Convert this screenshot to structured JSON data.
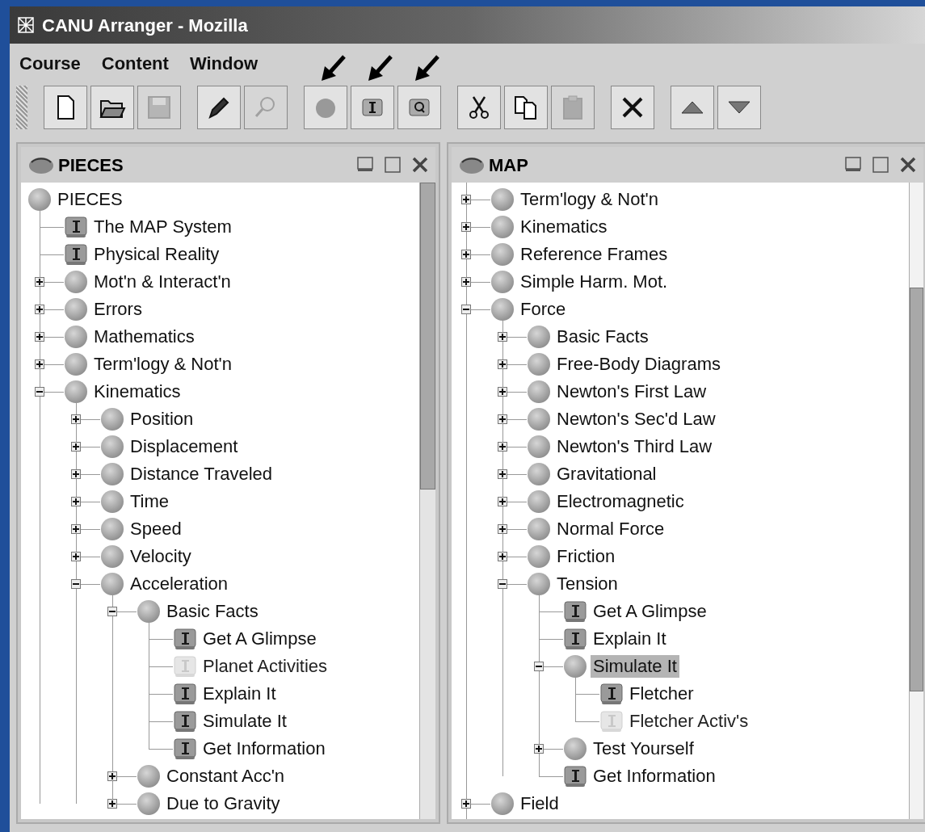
{
  "window": {
    "title": "CANU Arranger - Mozilla"
  },
  "menu": [
    "Course",
    "Content",
    "Window"
  ],
  "toolbar": [
    {
      "kind": "new",
      "disabled": false,
      "marked": false
    },
    {
      "kind": "open",
      "disabled": false,
      "marked": false
    },
    {
      "kind": "save",
      "disabled": true,
      "marked": false
    },
    {
      "kind": "sep"
    },
    {
      "kind": "pen",
      "disabled": false,
      "marked": false
    },
    {
      "kind": "find",
      "disabled": true,
      "marked": false
    },
    {
      "kind": "sep"
    },
    {
      "kind": "topic",
      "disabled": false,
      "marked": true
    },
    {
      "kind": "piece",
      "disabled": false,
      "marked": true
    },
    {
      "kind": "quiz",
      "disabled": false,
      "marked": true
    },
    {
      "kind": "sep"
    },
    {
      "kind": "cut",
      "disabled": false,
      "marked": false
    },
    {
      "kind": "copy",
      "disabled": false,
      "marked": false
    },
    {
      "kind": "paste",
      "disabled": true,
      "marked": false
    },
    {
      "kind": "sep"
    },
    {
      "kind": "delete",
      "disabled": false,
      "marked": false
    },
    {
      "kind": "sep"
    },
    {
      "kind": "up",
      "disabled": false,
      "marked": false
    },
    {
      "kind": "down",
      "disabled": false,
      "marked": false
    }
  ],
  "pieces": {
    "title": "PIECES",
    "root": {
      "kind": "topic",
      "label": "PIECES",
      "selected": false,
      "children": [
        {
          "kind": "piece",
          "label": "The MAP System",
          "dimmed": false,
          "selected": false
        },
        {
          "kind": "piece",
          "label": "Physical Reality",
          "dimmed": false,
          "selected": false
        },
        {
          "kind": "topic",
          "label": "Mot'n & Interact'n",
          "expanded": false,
          "selected": false
        },
        {
          "kind": "topic",
          "label": "Errors",
          "expanded": false,
          "selected": false
        },
        {
          "kind": "topic",
          "label": "Mathematics",
          "expanded": false,
          "selected": false
        },
        {
          "kind": "topic",
          "label": "Term'logy & Not'n",
          "expanded": false,
          "selected": false
        },
        {
          "kind": "topic",
          "label": "Kinematics",
          "expanded": true,
          "selected": false,
          "children": [
            {
              "kind": "topic",
              "label": "Position",
              "expanded": false,
              "selected": false
            },
            {
              "kind": "topic",
              "label": "Displacement",
              "expanded": false,
              "selected": false
            },
            {
              "kind": "topic",
              "label": "Distance Traveled",
              "expanded": false,
              "selected": false
            },
            {
              "kind": "topic",
              "label": "Time",
              "expanded": false,
              "selected": false
            },
            {
              "kind": "topic",
              "label": "Speed",
              "expanded": false,
              "selected": false
            },
            {
              "kind": "topic",
              "label": "Velocity",
              "expanded": false,
              "selected": false
            },
            {
              "kind": "topic",
              "label": "Acceleration",
              "expanded": true,
              "selected": false,
              "children": [
                {
                  "kind": "topic",
                  "label": "Basic Facts",
                  "expanded": true,
                  "selected": false,
                  "children": [
                    {
                      "kind": "piece",
                      "label": "Get A Glimpse",
                      "dimmed": false,
                      "selected": false
                    },
                    {
                      "kind": "piece",
                      "label": "Planet Activities",
                      "dimmed": true,
                      "selected": false
                    },
                    {
                      "kind": "piece",
                      "label": "Explain It",
                      "dimmed": false,
                      "selected": false
                    },
                    {
                      "kind": "piece",
                      "label": "Simulate It",
                      "dimmed": false,
                      "selected": false
                    },
                    {
                      "kind": "piece",
                      "label": "Get Information",
                      "dimmed": false,
                      "selected": false
                    }
                  ]
                },
                {
                  "kind": "topic",
                  "label": "Constant Acc'n",
                  "expanded": false,
                  "selected": false
                },
                {
                  "kind": "topic",
                  "label": "Due to Gravity",
                  "expanded": false,
                  "selected": false
                }
              ]
            }
          ]
        }
      ]
    }
  },
  "map": {
    "title": "MAP",
    "nodes": [
      {
        "kind": "topic",
        "label": "Term'logy & Not'n",
        "expanded": false,
        "selected": false
      },
      {
        "kind": "topic",
        "label": "Kinematics",
        "expanded": false,
        "selected": false
      },
      {
        "kind": "topic",
        "label": "Reference Frames",
        "expanded": false,
        "selected": false
      },
      {
        "kind": "topic",
        "label": "Simple Harm. Mot.",
        "expanded": false,
        "selected": false
      },
      {
        "kind": "topic",
        "label": "Force",
        "expanded": true,
        "selected": false,
        "children": [
          {
            "kind": "topic",
            "label": "Basic Facts",
            "expanded": false,
            "selected": false
          },
          {
            "kind": "topic",
            "label": "Free-Body Diagrams",
            "expanded": false,
            "selected": false
          },
          {
            "kind": "topic",
            "label": "Newton's First Law",
            "expanded": false,
            "selected": false
          },
          {
            "kind": "topic",
            "label": "Newton's Sec'd Law",
            "expanded": false,
            "selected": false
          },
          {
            "kind": "topic",
            "label": "Newton's Third Law",
            "expanded": false,
            "selected": false
          },
          {
            "kind": "topic",
            "label": "Gravitational",
            "expanded": false,
            "selected": false
          },
          {
            "kind": "topic",
            "label": "Electromagnetic",
            "expanded": false,
            "selected": false
          },
          {
            "kind": "topic",
            "label": "Normal Force",
            "expanded": false,
            "selected": false
          },
          {
            "kind": "topic",
            "label": "Friction",
            "expanded": false,
            "selected": false
          },
          {
            "kind": "topic",
            "label": "Tension",
            "expanded": true,
            "selected": false,
            "children": [
              {
                "kind": "piece",
                "label": "Get A Glimpse",
                "dimmed": false,
                "selected": false
              },
              {
                "kind": "piece",
                "label": "Explain It",
                "dimmed": false,
                "selected": false
              },
              {
                "kind": "topic",
                "label": "Simulate It",
                "expanded": true,
                "selected": true,
                "children": [
                  {
                    "kind": "piece",
                    "label": "Fletcher",
                    "dimmed": false,
                    "selected": false
                  },
                  {
                    "kind": "piece",
                    "label": "Fletcher Activ's",
                    "dimmed": true,
                    "selected": false
                  }
                ]
              },
              {
                "kind": "topic",
                "label": "Test Yourself",
                "expanded": false,
                "selected": false
              },
              {
                "kind": "piece",
                "label": "Get Information",
                "dimmed": false,
                "selected": false
              }
            ]
          }
        ]
      },
      {
        "kind": "topic",
        "label": "Field",
        "expanded": false,
        "selected": false
      }
    ]
  }
}
